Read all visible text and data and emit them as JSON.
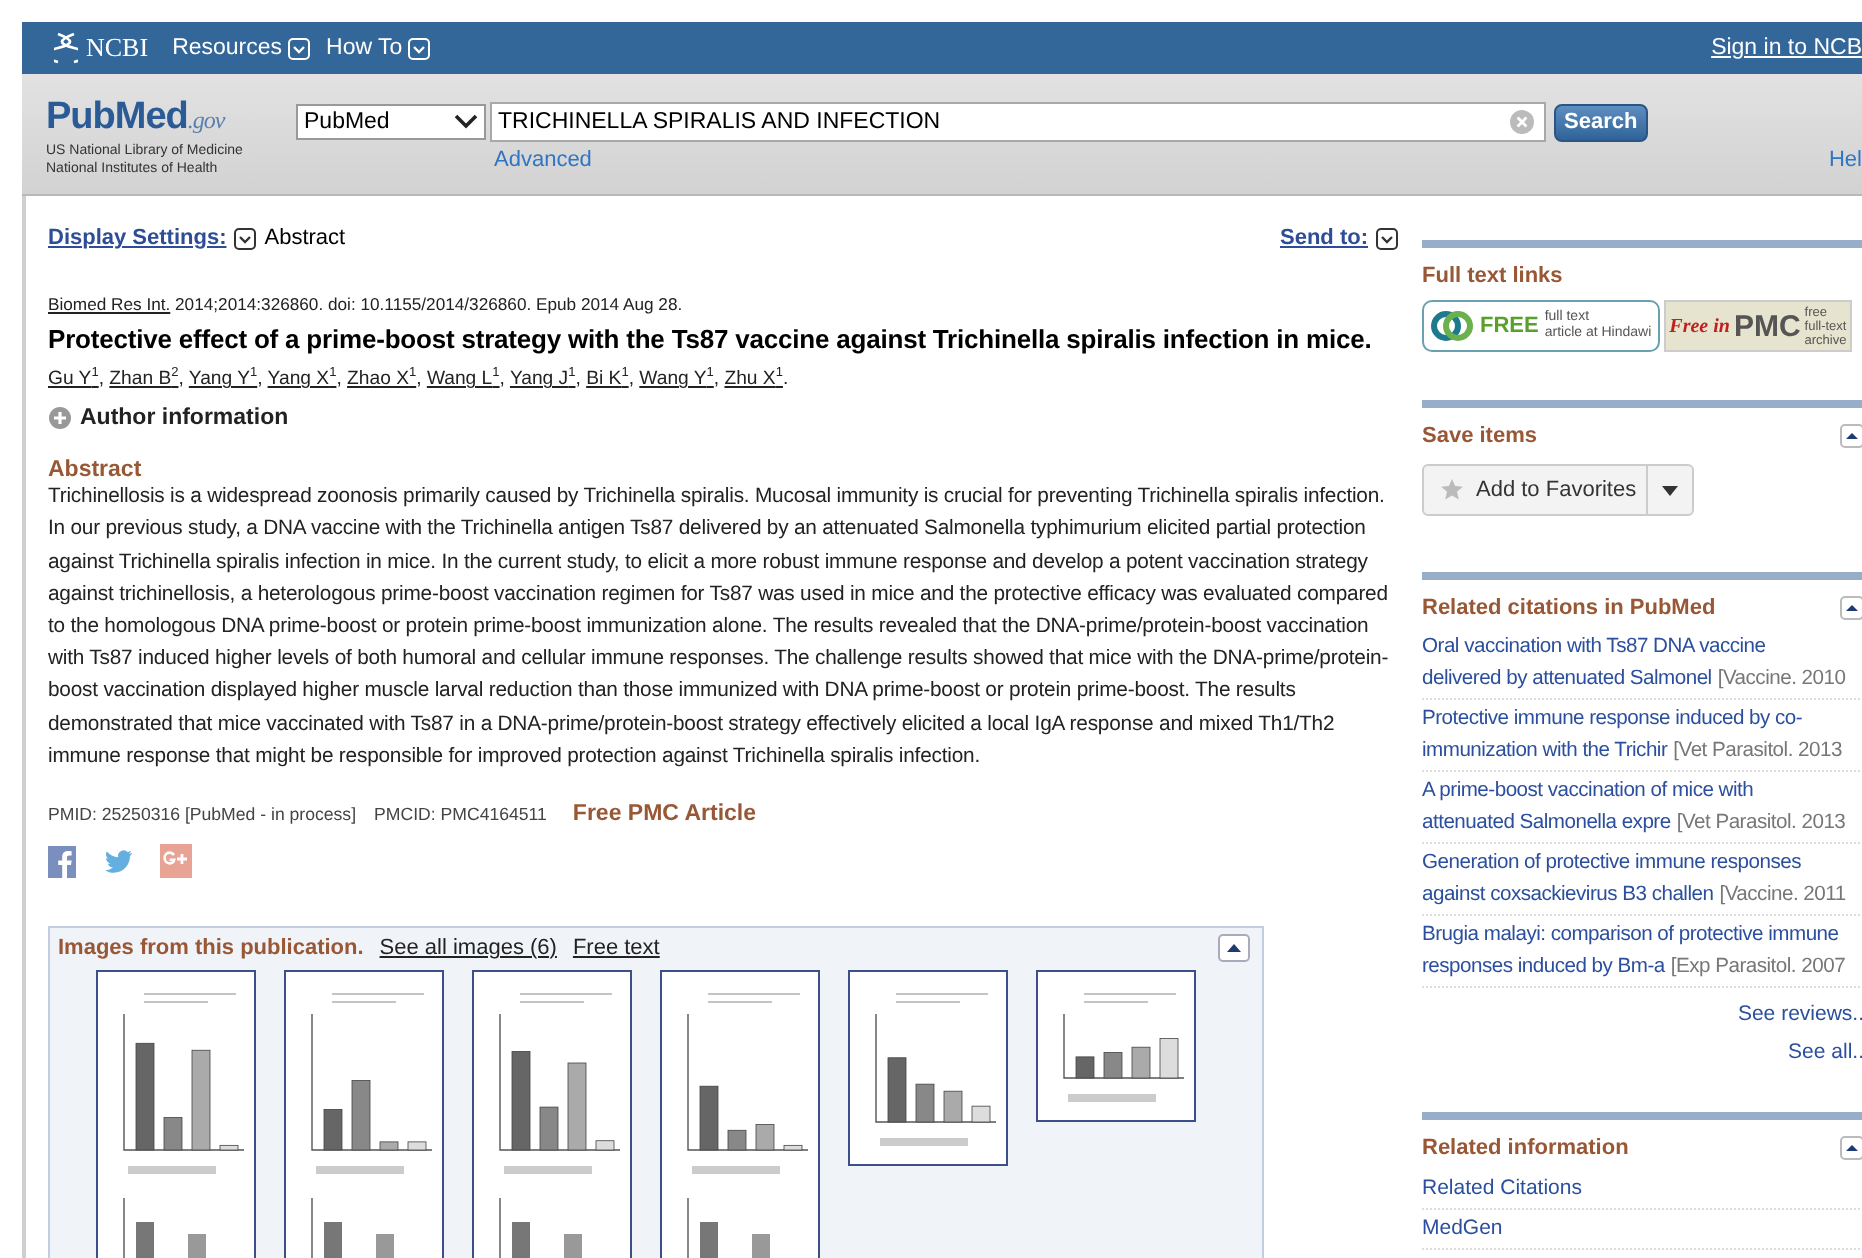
{
  "top_bar": {
    "logo": "NCBI",
    "menus": [
      {
        "label": "Resources"
      },
      {
        "label": "How To"
      }
    ],
    "sign_in": "Sign in to NCB"
  },
  "search_bar": {
    "logo_parts": [
      "Pub",
      "Med",
      ".gov"
    ],
    "logo_lines": [
      "US National Library of Medicine",
      "National Institutes of Health"
    ],
    "database": "PubMed",
    "query": "TRICHINELLA SPIRALIS AND INFECTION",
    "search_button": "Search",
    "advanced": "Advanced",
    "help": "Hel"
  },
  "display": {
    "settings": "Display Settings:",
    "format": "Abstract",
    "send_to": "Send to:"
  },
  "article": {
    "journal": "Biomed Res Int.",
    "citation": "2014;2014:326860. doi: 10.1155/2014/326860. Epub 2014 Aug 28.",
    "title": "Protective effect of a prime-boost strategy with the Ts87 vaccine against Trichinella spiralis infection in mice.",
    "authors": [
      {
        "name": "Gu Y",
        "mark": "1"
      },
      {
        "name": "Zhan B",
        "mark": "2"
      },
      {
        "name": "Yang Y",
        "mark": "1"
      },
      {
        "name": "Yang X",
        "mark": "1"
      },
      {
        "name": "Zhao X",
        "mark": "1"
      },
      {
        "name": "Wang L",
        "mark": "1"
      },
      {
        "name": "Yang J",
        "mark": "1"
      },
      {
        "name": "Bi K",
        "mark": "1"
      },
      {
        "name": "Wang Y",
        "mark": "1"
      },
      {
        "name": "Zhu X",
        "mark": "1"
      }
    ],
    "author_separator": ", ",
    "author_end": ".",
    "author_info": {
      "label": "Author information",
      "expanded": false
    },
    "abstract_heading": "Abstract",
    "abstract": "Trichinellosis is a widespread zoonosis primarily caused by Trichinella spiralis. Mucosal immunity is crucial for preventing Trichinella spiralis infection. In our previous study, a DNA vaccine with the Trichinella antigen Ts87 delivered by an attenuated Salmonella typhimurium elicited partial protection against Trichinella spiralis infection in mice. In the current study, to elicit a more robust immune response and develop a potent vaccination strategy against trichinellosis, a heterologous prime-boost vaccination regimen for Ts87 was used in mice and the protective efficacy was evaluated compared to the homologous DNA prime-boost or protein prime-boost immunization alone. The results revealed that the DNA-prime/protein-boost vaccination with Ts87 induced higher levels of both humoral and cellular immune responses. The challenge results showed that mice with the DNA-prime/protein-boost vaccination displayed higher muscle larval reduction than those immunized with DNA prime-boost or protein prime-boost. The results demonstrated that mice vaccinated with Ts87 in a DNA-prime/protein-boost strategy effectively elicited a local IgA response and mixed Th1/Th2 immune response that might be responsible for improved protection against Trichinella spiralis infection.",
    "pmid": "PMID: 25250316 [PubMed - in process]",
    "pmcid": "PMCID: PMC4164511",
    "free_pmc": "Free PMC Article"
  },
  "share": [
    {
      "kind": "facebook"
    },
    {
      "kind": "twitter"
    },
    {
      "kind": "googleplus"
    }
  ],
  "images_panel": {
    "title": "Images from this publication.",
    "links": [
      "See all images (6)",
      "Free text"
    ],
    "thumbnails": [
      {
        "kind": "picture"
      },
      {
        "kind": "picture"
      },
      {
        "kind": "picture"
      },
      {
        "kind": "picture"
      },
      {
        "kind": "picture"
      },
      {
        "kind": "picture"
      }
    ]
  },
  "sidebar": {
    "sections": [
      {
        "kind": "fulltext",
        "title": "Full text links",
        "badges": [
          {
            "kind": "hindawi",
            "big": "FREE",
            "lines": [
              "full text",
              "article at Hindawi"
            ]
          },
          {
            "kind": "pmc",
            "big": "PMC",
            "script": "Free in",
            "lines": [
              "free",
              "full-text",
              "archive"
            ]
          }
        ]
      },
      {
        "kind": "save",
        "title": "Save items",
        "button": "Add to Favorites"
      },
      {
        "kind": "citations",
        "title": "Related citations in PubMed",
        "items": [
          {
            "title_lines": [
              "Oral vaccination with Ts87 DNA vaccine",
              "delivered by attenuated Salmonel"
            ],
            "source": "[Vaccine. 2010"
          },
          {
            "title_lines": [
              "Protective immune response induced by co-",
              "immunization with the Trichir"
            ],
            "source": "[Vet Parasitol. 2013"
          },
          {
            "title_lines": [
              "A prime-boost vaccination of mice with",
              "attenuated Salmonella expre"
            ],
            "source": "[Vet Parasitol. 2013"
          },
          {
            "title_lines": [
              "Generation of protective immune responses",
              "against coxsackievirus B3 challen"
            ],
            "source": "[Vaccine. 2011"
          },
          {
            "title_lines": [
              "Brugia malayi: comparison of protective immune",
              "responses induced by Bm-a"
            ],
            "source": "[Exp Parasitol. 2007"
          }
        ],
        "more": [
          "See reviews..",
          "See all.."
        ]
      },
      {
        "kind": "info",
        "title": "Related information",
        "items": [
          "Related Citations",
          "MedGen"
        ]
      }
    ]
  }
}
